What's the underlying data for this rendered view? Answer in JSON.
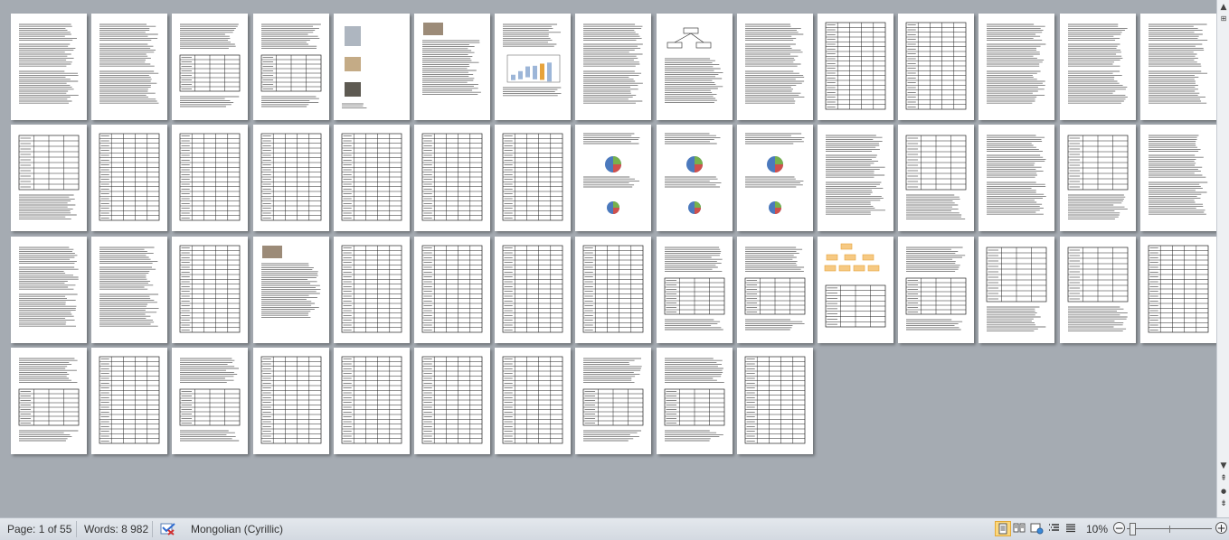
{
  "document": {
    "page_count": 55,
    "pages_per_row": 15,
    "page_layouts": [
      "text",
      "text",
      "text-table",
      "text-table",
      "images",
      "image-text",
      "chart-text",
      "text",
      "diagram-text",
      "text",
      "table",
      "table",
      "text",
      "text",
      "text",
      "table-text",
      "table",
      "table",
      "table",
      "table",
      "table",
      "table",
      "pie-text",
      "pie-text",
      "pie-text",
      "text",
      "table-text",
      "text",
      "table-text",
      "text",
      "text",
      "text",
      "table",
      "image-text",
      "table",
      "table",
      "table",
      "table",
      "text-table",
      "text-table",
      "diagram-table",
      "text-table",
      "table-text",
      "table-text",
      "table",
      "text-table",
      "table",
      "text-table",
      "table",
      "table",
      "table",
      "table",
      "text-table",
      "text-table",
      "table"
    ]
  },
  "statusbar": {
    "page_label": "Page: 1 of 55",
    "words_label": "Words: 8 982",
    "language": "Mongolian (Cyrillic)",
    "zoom_label": "10%",
    "zoom_out": "−",
    "zoom_in": "+"
  },
  "scrollbar": {
    "up_arrow": "▲",
    "down_arrow": "▼",
    "prev_page": "⇞",
    "browse_object": "●",
    "next_page": "⇟"
  },
  "icons": {
    "spell-check": "spell-check-icon",
    "print-layout": "print-layout-icon",
    "full-screen-reading": "full-screen-reading-icon",
    "web-layout": "web-layout-icon",
    "outline": "outline-icon",
    "draft": "draft-icon"
  },
  "colors": {
    "workspace_bg": "#a5abb2",
    "active_view": "#fbd77c",
    "chart_orange": "#e7a33b",
    "pie_green": "#77b14c",
    "pie_red": "#d0504c",
    "pie_blue": "#4b79bd"
  }
}
